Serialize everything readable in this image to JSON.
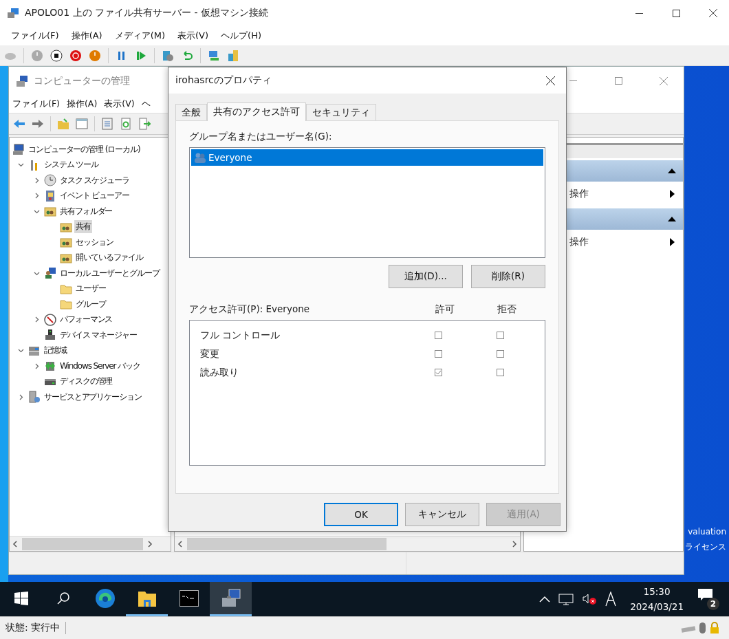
{
  "vm_window": {
    "title": "APOLO01 上の ファイル共有サーバー - 仮想マシン接続"
  },
  "vm_menu": [
    "ファイル(F)",
    "操作(A)",
    "メディア(M)",
    "表示(V)",
    "ヘルプ(H)"
  ],
  "mgmt_window": {
    "title": "コンピューターの管理",
    "menu": [
      "ファイル(F)",
      "操作(A)",
      "表示(V)",
      "ヘ"
    ],
    "tree": [
      {
        "label": "コンピューターの管理 (ローカル)",
        "kind": "computer",
        "selected": false,
        "children": [
          {
            "label": "システム ツール",
            "kind": "tools",
            "expanded": true,
            "selected": false,
            "children": [
              {
                "label": "タスク スケジューラ",
                "kind": "clock",
                "expanded": false,
                "selected": false
              },
              {
                "label": "イベント ビューアー",
                "kind": "event",
                "expanded": false,
                "selected": false
              },
              {
                "label": "共有フォルダー",
                "kind": "share",
                "expanded": true,
                "selected": false,
                "children": [
                  {
                    "label": "共有",
                    "kind": "share",
                    "selected": true
                  },
                  {
                    "label": "セッション",
                    "kind": "share",
                    "selected": false
                  },
                  {
                    "label": "開いているファイル",
                    "kind": "share",
                    "selected": false
                  }
                ]
              },
              {
                "label": "ローカル ユーザーとグループ",
                "kind": "users",
                "expanded": true,
                "selected": false,
                "children": [
                  {
                    "label": "ユーザー",
                    "kind": "folder",
                    "selected": false
                  },
                  {
                    "label": "グループ",
                    "kind": "folder",
                    "selected": false
                  }
                ]
              },
              {
                "label": "パフォーマンス",
                "kind": "gauge",
                "expanded": false,
                "selected": false
              },
              {
                "label": "デバイス マネージャー",
                "kind": "device",
                "selected": false
              }
            ]
          },
          {
            "label": "記憶域",
            "kind": "storage",
            "expanded": true,
            "selected": false,
            "children": [
              {
                "label": "Windows Server バック",
                "kind": "backup",
                "expanded": false,
                "selected": false
              },
              {
                "label": "ディスクの管理",
                "kind": "disk",
                "selected": false
              }
            ]
          },
          {
            "label": "サービスとアプリケーション",
            "kind": "services",
            "expanded": false,
            "selected": false
          }
        ]
      }
    ],
    "actions": [
      {
        "label": "操作",
        "expanded": true
      },
      {
        "label": "操作",
        "expanded": true
      }
    ]
  },
  "dialog": {
    "title": "irohasrcのプロパティ",
    "tabs": [
      {
        "label": "全般",
        "selected": false
      },
      {
        "label": "共有のアクセス許可",
        "selected": true
      },
      {
        "label": "セキュリティ",
        "selected": false
      }
    ],
    "users_label": "グループ名またはユーザー名(G):",
    "users": [
      {
        "name": "Everyone",
        "selected": true
      }
    ],
    "user_buttons": [
      "追加(D)...",
      "削除(R)"
    ],
    "permissions_label": "アクセス許可(P): Everyone",
    "allow_header": "許可",
    "deny_header": "拒否",
    "permissions": [
      {
        "name": "フル コントロール",
        "allow": false,
        "deny": false
      },
      {
        "name": "変更",
        "allow": false,
        "deny": false
      },
      {
        "name": "読み取り",
        "allow": true,
        "deny": false
      }
    ],
    "buttons": [
      {
        "label": "OK",
        "disabled": false,
        "default": true
      },
      {
        "label": "キャンセル",
        "disabled": false,
        "default": false
      },
      {
        "label": "適用(A)",
        "disabled": true,
        "default": false
      }
    ]
  },
  "desktop_text": [
    "valuation",
    "ライセンス"
  ],
  "taskbar": {
    "apps": [
      {
        "kind": "start",
        "running": false,
        "selected": false
      },
      {
        "kind": "search",
        "running": false,
        "selected": false
      },
      {
        "kind": "edge",
        "running": false,
        "selected": false
      },
      {
        "kind": "explorer",
        "running": true,
        "selected": false
      },
      {
        "kind": "terminal",
        "running": false,
        "selected": false
      },
      {
        "kind": "manager",
        "running": true,
        "selected": true
      }
    ],
    "time": "15:30",
    "date": "2024/03/21",
    "notifications": "2"
  },
  "status": "状態: 実行中"
}
